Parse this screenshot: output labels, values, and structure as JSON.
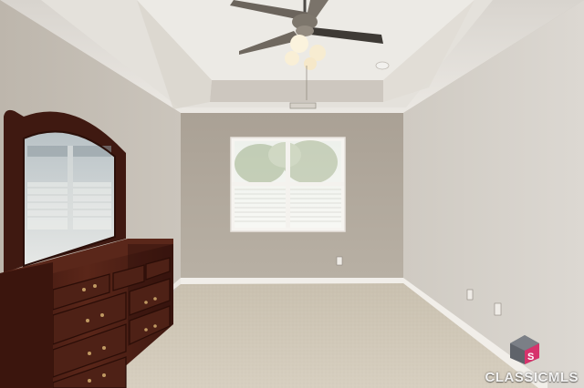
{
  "photo": {
    "subject": "empty-bedroom-with-tray-ceiling",
    "objects": [
      "ceiling-fan",
      "window",
      "dresser-with-mirror",
      "carpet-floor",
      "baseboard",
      "wall-outlet"
    ]
  },
  "watermark": {
    "text": "CLASSICMLS",
    "logo_icon": "classic-mls-logo-icon",
    "logo_colors": [
      "#6b6f75",
      "#d6336c"
    ]
  },
  "palette": {
    "ceiling": "#e9e6e1",
    "back_wall": "#b2a99d",
    "side_wall_left": "#c7c1b8",
    "side_wall_right": "#d3cec7",
    "carpet": "#cfc6b5",
    "trim": "#f1eee9",
    "dresser": "#4a1f16"
  }
}
